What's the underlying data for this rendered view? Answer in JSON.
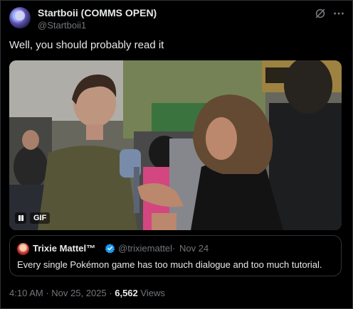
{
  "author": {
    "display_name": "Startboii (COMMS OPEN)",
    "handle": "@Startboii1"
  },
  "tweet": {
    "text": "Well, you should probably read it"
  },
  "media": {
    "type": "gif",
    "badge_label": "GIF",
    "pause_icon": "pause-icon"
  },
  "quoted": {
    "display_name": "Trixie Mattel™",
    "handle": "@trixiemattel",
    "separator": "·",
    "date": "Nov 24",
    "text": "Every single Pokémon game has too much dialogue and too much tutorial.",
    "verified_color": "#1d9bf0"
  },
  "meta": {
    "time": "4:10 AM",
    "sep1": "·",
    "date": "Nov 25, 2025",
    "sep2": "·",
    "views_count": "6,562",
    "views_label": "Views"
  },
  "icons": {
    "grok": "grok-icon",
    "more": "more-icon"
  },
  "colors": {
    "background": "#000000",
    "text": "#e7e9ea",
    "secondary": "#71767b",
    "border": "#2f3336",
    "verified": "#1d9bf0"
  }
}
